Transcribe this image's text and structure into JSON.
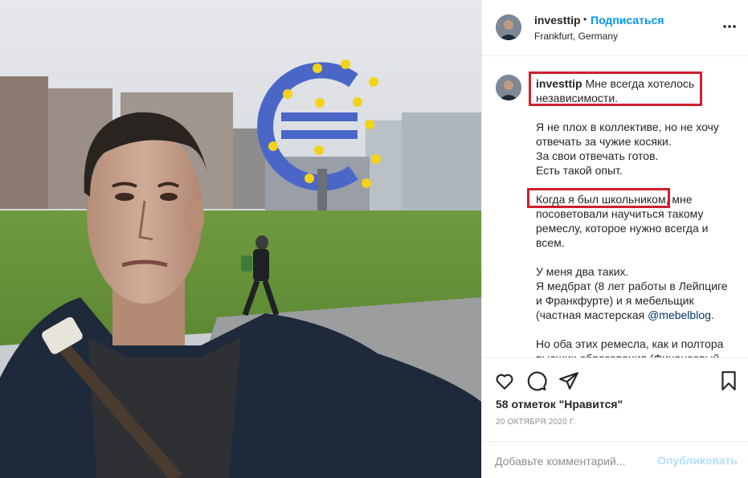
{
  "post": {
    "username": "investtip",
    "separator": "•",
    "follow_label": "Подписаться",
    "location": "Frankfurt, Germany",
    "more_icon": "more-horizontal-icon"
  },
  "caption": {
    "username": "investtip",
    "lines": [
      "Мне всегда хотелось",
      "независимости.",
      "",
      "Я не плох в коллективе, но не хочу",
      "отвечать за чужие косяки.",
      "За свои отвечать готов.",
      "Есть такой опыт.",
      "",
      "Когда я был школьником, мне",
      "посоветовали научиться такому",
      "ремеслу, которое нужно всегда и",
      "всем.",
      "",
      "У меня два таких.",
      "Я медбрат (8 лет работы в Лейпциге",
      "и Франкфурте) и я мебельщик",
      "(частная мастерская ",
      "@mebelblog",
      ".",
      "",
      "Но оба этих ремесла, как и полтора",
      "высших образования (Финансовый"
    ]
  },
  "actions": {
    "icons": [
      "heart-icon",
      "comment-icon",
      "share-icon",
      "bookmark-icon"
    ],
    "likes": "58 отметок \"Нравится\"",
    "date": "20 ОКТЯБРЯ 2020 Г."
  },
  "comment_form": {
    "placeholder": "Добавьте комментарий...",
    "publish_label": "Опубликовать"
  },
  "colors": {
    "link_blue": "#0095f6",
    "mention_blue": "#00376b",
    "highlight_red": "#d21f2f",
    "muted_gray": "#8e8e8e",
    "publish_disabled": "#b2dffc"
  }
}
